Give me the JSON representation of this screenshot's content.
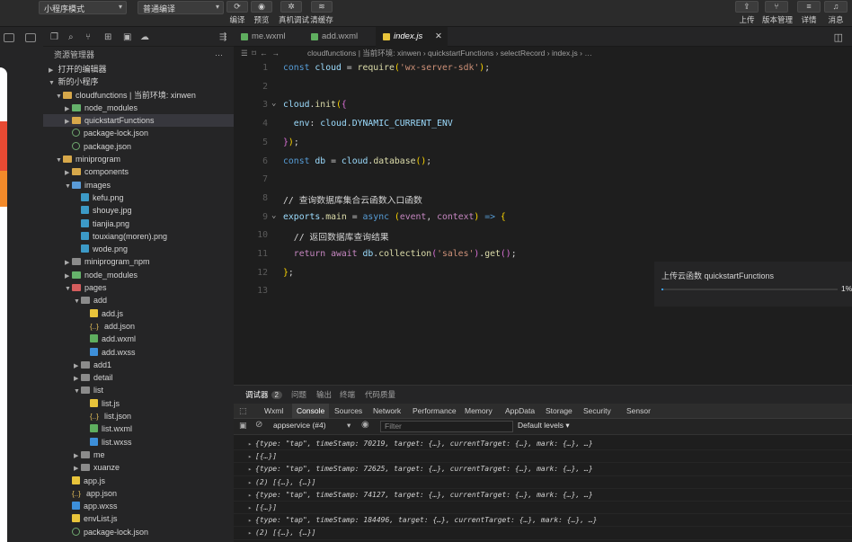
{
  "toolbar": {
    "mode_select": "小程序模式",
    "compile_select": "普通编译",
    "buttons": [
      {
        "label": "编译",
        "icon": "refresh-icon"
      },
      {
        "label": "预览",
        "icon": "eye-icon"
      },
      {
        "label": "真机调试",
        "icon": "bug-icon"
      },
      {
        "label": "清缓存",
        "icon": "layers-icon"
      }
    ],
    "right_buttons": [
      {
        "label": "上传",
        "icon": "upload-icon"
      },
      {
        "label": "版本管理",
        "icon": "branch-icon"
      },
      {
        "label": "详情",
        "icon": "menu-icon"
      },
      {
        "label": "消息",
        "icon": "bell-icon"
      }
    ]
  },
  "explorer": {
    "title": "资源管理器",
    "more": "···",
    "open_editors": "打开的编辑器",
    "project": "新的小程序",
    "tree": [
      {
        "label": "cloudfunctions | 当前环境: xinwen",
        "depth": 1,
        "type": "folder-cloud",
        "expanded": true
      },
      {
        "label": "node_modules",
        "depth": 2,
        "type": "folder-green",
        "expanded": false
      },
      {
        "label": "quickstartFunctions",
        "depth": 2,
        "type": "folder",
        "expanded": false,
        "selected": true
      },
      {
        "label": "package-lock.json",
        "depth": 2,
        "type": "lock"
      },
      {
        "label": "package.json",
        "depth": 2,
        "type": "lock"
      },
      {
        "label": "miniprogram",
        "depth": 1,
        "type": "folder",
        "expanded": true
      },
      {
        "label": "components",
        "depth": 2,
        "type": "folder",
        "expanded": false
      },
      {
        "label": "images",
        "depth": 2,
        "type": "folder-blue",
        "expanded": true
      },
      {
        "label": "kefu.png",
        "depth": 3,
        "type": "img"
      },
      {
        "label": "shouye.jpg",
        "depth": 3,
        "type": "img"
      },
      {
        "label": "tianjia.png",
        "depth": 3,
        "type": "img"
      },
      {
        "label": "touxiang(moren).png",
        "depth": 3,
        "type": "img"
      },
      {
        "label": "wode.png",
        "depth": 3,
        "type": "img"
      },
      {
        "label": "miniprogram_npm",
        "depth": 2,
        "type": "folder-grey",
        "expanded": false
      },
      {
        "label": "node_modules",
        "depth": 2,
        "type": "folder-green",
        "expanded": false
      },
      {
        "label": "pages",
        "depth": 2,
        "type": "folder-red",
        "expanded": true
      },
      {
        "label": "add",
        "depth": 3,
        "type": "folder-grey",
        "expanded": true
      },
      {
        "label": "add.js",
        "depth": 4,
        "type": "js"
      },
      {
        "label": "add.json",
        "depth": 4,
        "type": "json"
      },
      {
        "label": "add.wxml",
        "depth": 4,
        "type": "wxml"
      },
      {
        "label": "add.wxss",
        "depth": 4,
        "type": "wxss"
      },
      {
        "label": "add1",
        "depth": 3,
        "type": "folder-grey",
        "expanded": false
      },
      {
        "label": "detail",
        "depth": 3,
        "type": "folder-grey",
        "expanded": false
      },
      {
        "label": "list",
        "depth": 3,
        "type": "folder-grey",
        "expanded": true
      },
      {
        "label": "list.js",
        "depth": 4,
        "type": "js"
      },
      {
        "label": "list.json",
        "depth": 4,
        "type": "json"
      },
      {
        "label": "list.wxml",
        "depth": 4,
        "type": "wxml"
      },
      {
        "label": "list.wxss",
        "depth": 4,
        "type": "wxss"
      },
      {
        "label": "me",
        "depth": 3,
        "type": "folder-grey",
        "expanded": false
      },
      {
        "label": "xuanze",
        "depth": 3,
        "type": "folder-grey",
        "expanded": false
      },
      {
        "label": "app.js",
        "depth": 2,
        "type": "js"
      },
      {
        "label": "app.json",
        "depth": 2,
        "type": "json"
      },
      {
        "label": "app.wxss",
        "depth": 2,
        "type": "wxss"
      },
      {
        "label": "envList.js",
        "depth": 2,
        "type": "js"
      },
      {
        "label": "package-lock.json",
        "depth": 2,
        "type": "lock"
      }
    ]
  },
  "tabs": [
    {
      "label": "me.wxml",
      "type": "wxml",
      "active": false
    },
    {
      "label": "add.wxml",
      "type": "wxml",
      "active": false
    },
    {
      "label": "index.js",
      "type": "js",
      "active": true
    }
  ],
  "breadcrumb": {
    "path": "cloudfunctions | 当前环境: xinwen  ›  quickstartFunctions  ›  selectRecord  ›  index.js  ›  …"
  },
  "code": {
    "line_numbers": [
      "1",
      "2",
      "3",
      "4",
      "5",
      "6",
      "7",
      "8",
      "9",
      "10",
      "11",
      "12",
      "13"
    ]
  },
  "upload": {
    "title": "上传云函数 quickstartFunctions",
    "progress": 1,
    "percent_text": "1%"
  },
  "debugger": {
    "tabs": [
      {
        "label": "调试器",
        "badge": "2",
        "active": true
      },
      {
        "label": "问题",
        "active": false
      },
      {
        "label": "输出",
        "active": false
      },
      {
        "label": "终端",
        "active": false
      },
      {
        "label": "代码质量",
        "active": false
      }
    ],
    "devtools_tabs": [
      "Wxml",
      "Console",
      "Sources",
      "Network",
      "Performance",
      "Memory",
      "AppData",
      "Storage",
      "Security",
      "Sensor"
    ],
    "active_devtools_tab": "Console",
    "context": "appservice (#4)",
    "filter_placeholder": "Filter",
    "levels": "Default levels ▾",
    "console_lines": [
      {
        "prefix": "▸",
        "text": "{type: \"tap\", timeStamp: 70219, target: {…}, currentTarget: {…}, mark: {…}, …}"
      },
      {
        "prefix": "▸",
        "text": "[{…}]"
      },
      {
        "prefix": "▸",
        "text": "{type: \"tap\", timeStamp: 72625, target: {…}, currentTarget: {…}, mark: {…}, …}"
      },
      {
        "prefix": "▸",
        "text": "(2) [{…}, {…}]"
      },
      {
        "prefix": "▸",
        "text": "{type: \"tap\", timeStamp: 74127, target: {…}, currentTarget: {…}, mark: {…}, …}"
      },
      {
        "prefix": "▸",
        "text": "[{…}]"
      },
      {
        "prefix": "▸",
        "text": "{type: \"tap\", timeStamp: 184496, target: {…}, currentTarget: {…}, mark: {…}, …}"
      },
      {
        "prefix": "▸",
        "text": "(2) [{…}, {…}]"
      }
    ]
  }
}
